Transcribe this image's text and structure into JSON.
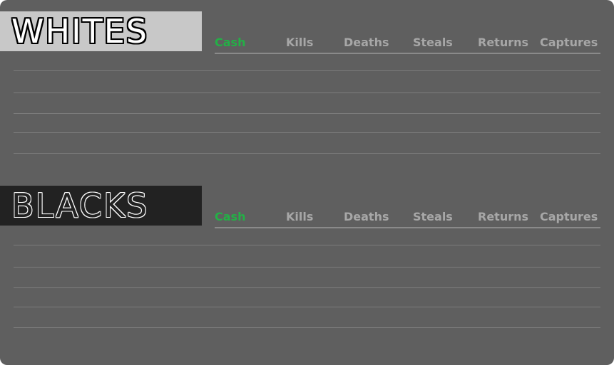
{
  "teams": [
    {
      "name": "WHITES",
      "columns": [
        "Cash",
        "Kills",
        "Deaths",
        "Steals",
        "Returns",
        "Captures"
      ],
      "active_column": "Cash"
    },
    {
      "name": "BLACKS",
      "columns": [
        "Cash",
        "Kills",
        "Deaths",
        "Steals",
        "Returns",
        "Captures"
      ],
      "active_column": "Cash"
    }
  ],
  "colors": {
    "panel": "#5f5f5f",
    "whites_banner": "#c8c8c8",
    "blacks_banner": "#222222",
    "active_column": "#23b046",
    "inactive_column": "#a7a7a7"
  }
}
